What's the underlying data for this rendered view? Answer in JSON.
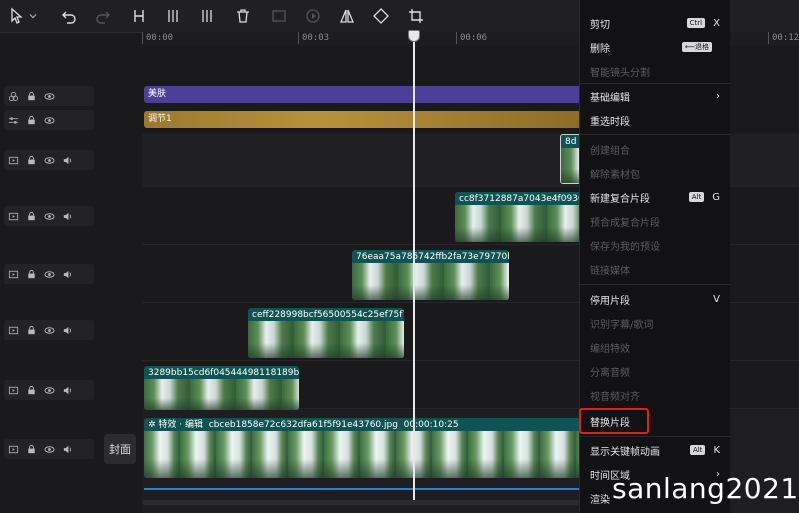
{
  "ruler": {
    "ticks": [
      "00:00",
      "00:03",
      "00:06",
      "00:12"
    ]
  },
  "tracks": {
    "beauty_label": "美肤",
    "adjust_label": "调节1",
    "clip_row1": "8d",
    "clip_row2": "cc8f3712887a7043e4f09368",
    "clip_row3": "76eaa75a785742ffb2fa73e79770b28",
    "clip_row4": "ceff228998bcf56500554c25ef75f791",
    "clip_row5": "3289bb15cd6f04544498118189b7ae",
    "main_effect": "特效 · 编辑",
    "main_file": "cbceb1858e72c632dfa61f5f91e43760.jpg",
    "main_duration": "00:00:10:25",
    "cover": "封面"
  },
  "menu": {
    "items": [
      {
        "label": "剪切",
        "kbd": "Ctrl",
        "key": "X"
      },
      {
        "label": "删除",
        "kbd": "⟵退格",
        "key": ""
      },
      {
        "label": "智能镜头分割"
      },
      {
        "label": "基础编辑",
        "key": "›"
      },
      {
        "label": "重选时段"
      },
      {
        "label": "创建组合"
      },
      {
        "label": "解除素材包"
      },
      {
        "label": "新建复合片段",
        "kbd": "Alt",
        "key": "G"
      },
      {
        "label": "预合成复合片段"
      },
      {
        "label": "保存为我的预设"
      },
      {
        "label": "链接媒体"
      },
      {
        "label": "停用片段",
        "key": "V"
      },
      {
        "label": "识别字幕/歌词"
      },
      {
        "label": "编组特效"
      },
      {
        "label": "分离音频"
      },
      {
        "label": "视音频对齐"
      },
      {
        "label": "替换片段"
      },
      {
        "label": "显示关键帧动画",
        "kbd": "Alt",
        "key": "K"
      },
      {
        "label": "时间区域",
        "key": "›"
      },
      {
        "label": "渲染"
      }
    ]
  },
  "watermark": "sanlang2021"
}
